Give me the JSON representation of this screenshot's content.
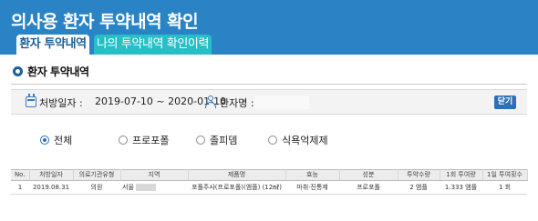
{
  "header": {
    "title": "의사용 환자 투약내역 확인",
    "tabs": [
      {
        "label": "환자 투약내역",
        "active": true
      },
      {
        "label": "나의 투약내역 확인이력",
        "active": false
      }
    ],
    "accent_color": "#2a83c4",
    "tab_inactive_color": "#27bfc7"
  },
  "section": {
    "title": "환자 투약내역"
  },
  "info": {
    "period_label": "처방일자 :",
    "period_value": "2019-07-10 ~ 2020-01-10",
    "patient_label": "환자명 :",
    "patient_name": "",
    "close_label": "닫기"
  },
  "filters": {
    "options": [
      "전체",
      "프로포폴",
      "졸피뎀",
      "식욕억제제"
    ],
    "selected": "전체"
  },
  "table": {
    "columns": [
      "No.",
      "처방일자",
      "의료기관유형",
      "지역",
      "제품명",
      "효능",
      "성분",
      "투약수량",
      "1회 투여량",
      "1일 투여횟수"
    ],
    "rows": [
      [
        "1",
        "2019.08.31",
        "의원",
        "서울",
        "포폴주사(프로포폴)(앰플) (12㎖)",
        "마취·진통제",
        "프로포폴",
        "2 앰플",
        "1.333 앰플",
        "1 회"
      ]
    ]
  }
}
